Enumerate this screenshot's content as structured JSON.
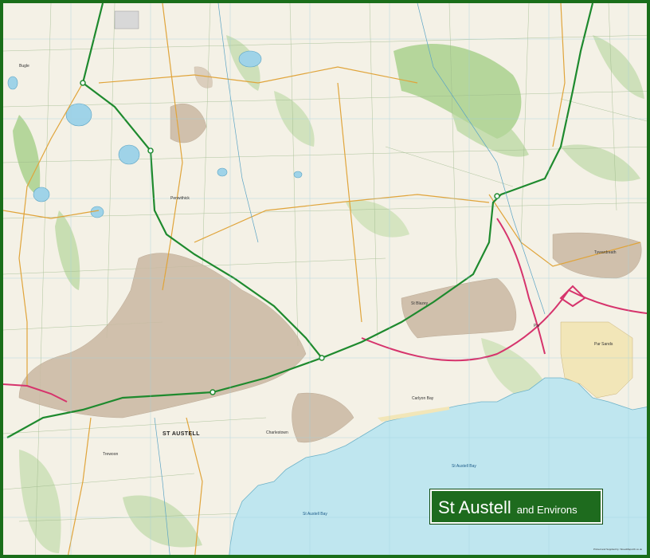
{
  "title": {
    "main": "St Austell",
    "sub": "and Environs"
  },
  "labels": {
    "st_austell": "ST AUSTELL",
    "st_austell_bay_east": "St Austell Bay",
    "st_austell_bay_west": "St Austell Bay",
    "tywardreath": "Tywardreath",
    "par": "Par",
    "st_blazey": "St Blazey",
    "charlestown": "Charlestown",
    "trewoon": "Trewoon",
    "carlyon_bay": "Carlyon Bay",
    "bugle": "Bugle",
    "penwithick": "Penwithick",
    "par_sands": "Par Sands"
  },
  "footer": {
    "publisher": "Printed and Supplied by: StreetMapsUK.co.uk"
  },
  "colors": {
    "frame": "#1a6e1a",
    "sea": "#bfe6ef",
    "land": "#f4f1e6",
    "woodland": "#a9d18e",
    "urban": "#c9b8a2",
    "a_road": "#1e8a2e",
    "railway": "#d6336c",
    "title_bg": "#1e6b1e",
    "sand": "#f2e6b8"
  }
}
